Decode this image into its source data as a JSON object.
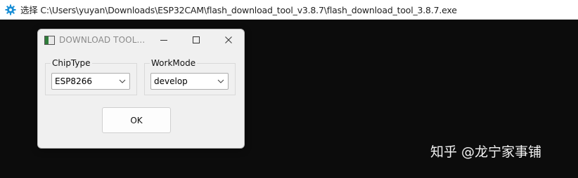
{
  "console": {
    "title": "选择 C:\\Users\\yuyan\\Downloads\\ESP32CAM\\flash_download_tool_v3.8.7\\flash_download_tool_3.8.7.exe",
    "icon": "gear-icon"
  },
  "dialog": {
    "title": "DOWNLOAD TOOL...",
    "controls": {
      "minimize": "minimize-icon",
      "maximize": "maximize-icon",
      "close": "close-icon"
    },
    "chip_type": {
      "label": "ChipType",
      "value": "ESP8266"
    },
    "work_mode": {
      "label": "WorkMode",
      "value": "develop"
    },
    "ok_label": "OK"
  },
  "watermark": {
    "text": "知乎 @龙宁家事铺"
  },
  "colors": {
    "console_bg": "#0c0c0c",
    "dialog_bg": "#f0f0f0",
    "titlebar_bg": "#ffffff",
    "gear_accent": "#1a8fd6"
  }
}
